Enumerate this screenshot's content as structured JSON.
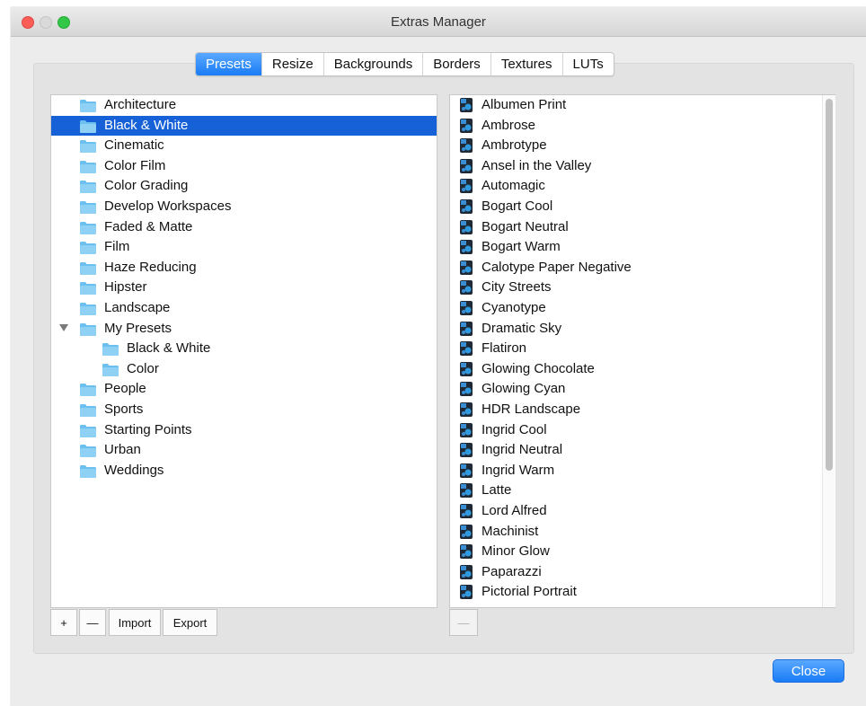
{
  "window": {
    "title": "Extras Manager"
  },
  "tabs": [
    {
      "label": "Presets",
      "active": true
    },
    {
      "label": "Resize",
      "active": false
    },
    {
      "label": "Backgrounds",
      "active": false
    },
    {
      "label": "Borders",
      "active": false
    },
    {
      "label": "Textures",
      "active": false
    },
    {
      "label": "LUTs",
      "active": false
    }
  ],
  "tree": [
    {
      "label": "Architecture"
    },
    {
      "label": "Black & White",
      "selected": true
    },
    {
      "label": "Cinematic"
    },
    {
      "label": "Color Film"
    },
    {
      "label": "Color Grading"
    },
    {
      "label": "Develop Workspaces"
    },
    {
      "label": "Faded & Matte"
    },
    {
      "label": "Film"
    },
    {
      "label": "Haze Reducing"
    },
    {
      "label": "Hipster"
    },
    {
      "label": "Landscape"
    },
    {
      "label": "My Presets",
      "expanded": true
    },
    {
      "label": "Black & White",
      "child": true
    },
    {
      "label": "Color",
      "child": true
    },
    {
      "label": "People"
    },
    {
      "label": "Sports"
    },
    {
      "label": "Starting Points"
    },
    {
      "label": "Urban"
    },
    {
      "label": "Weddings"
    }
  ],
  "presets": [
    "Albumen Print",
    "Ambrose",
    "Ambrotype",
    "Ansel in the Valley",
    "Automagic",
    "Bogart Cool",
    "Bogart Neutral",
    "Bogart Warm",
    "Calotype Paper Negative",
    "City Streets",
    "Cyanotype",
    "Dramatic Sky",
    "Flatiron",
    "Glowing Chocolate",
    "Glowing Cyan",
    "HDR Landscape",
    "Ingrid Cool",
    "Ingrid Neutral",
    "Ingrid Warm",
    "Latte",
    "Lord Alfred",
    "Machinist",
    "Minor Glow",
    "Paparazzi",
    "Pictorial Portrait"
  ],
  "buttons": {
    "add": "+",
    "remove": "—",
    "import": "Import",
    "export": "Export",
    "remove_preset": "—",
    "close": "Close"
  },
  "colors": {
    "accent": "#1a7bf5",
    "selection": "#1761d8",
    "folder": "#6cc0ef"
  },
  "icons": {
    "folder": "folder-icon",
    "preset": "preset-icon",
    "disclosure": "disclosure-triangle-icon"
  }
}
